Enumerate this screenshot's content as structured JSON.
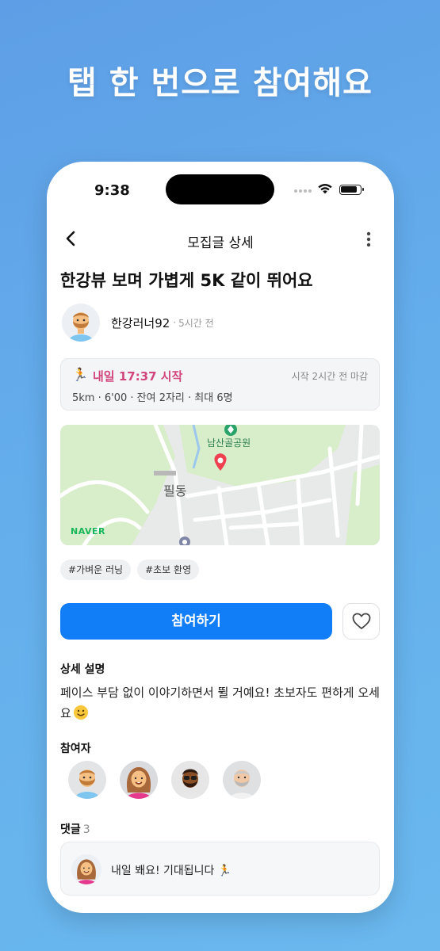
{
  "headline": "탭 한 번으로 참여해요",
  "status_bar": {
    "time": "9:38"
  },
  "nav": {
    "title": "모집글 상세"
  },
  "post": {
    "title": "한강뷰 보며 가볍게 5K 같이 뛰어요",
    "author": "한강러너92",
    "separator": "·",
    "posted_ago": "5시간 전"
  },
  "schedule": {
    "run_emoji": "🏃",
    "start": "내일 17:37 시작",
    "deadline": "시작 2시간 전 마감",
    "details": "5km · 6'00 · 잔여 2자리 · 최대 6명"
  },
  "map": {
    "park_label": "남산골공원",
    "district_label": "필동",
    "brand": "NAVER"
  },
  "tags": [
    "#가벼운 러닝",
    "#초보 환영"
  ],
  "actions": {
    "join_label": "참여하기"
  },
  "description": {
    "heading": "상세 설명",
    "text": "페이스 부담 없이 이야기하면서 뛸 거예요! 초보자도 편하게 오세요"
  },
  "participants": {
    "heading": "참여자",
    "count": 4
  },
  "comments": {
    "heading": "댓글",
    "count": "3",
    "items": [
      {
        "text": "내일 봬요! 기대됩니다 🏃"
      }
    ]
  },
  "colors": {
    "primary": "#117ef8",
    "accent_pink": "#d1467d",
    "map_pin": "#ef4050",
    "naver_green": "#19b65c"
  }
}
